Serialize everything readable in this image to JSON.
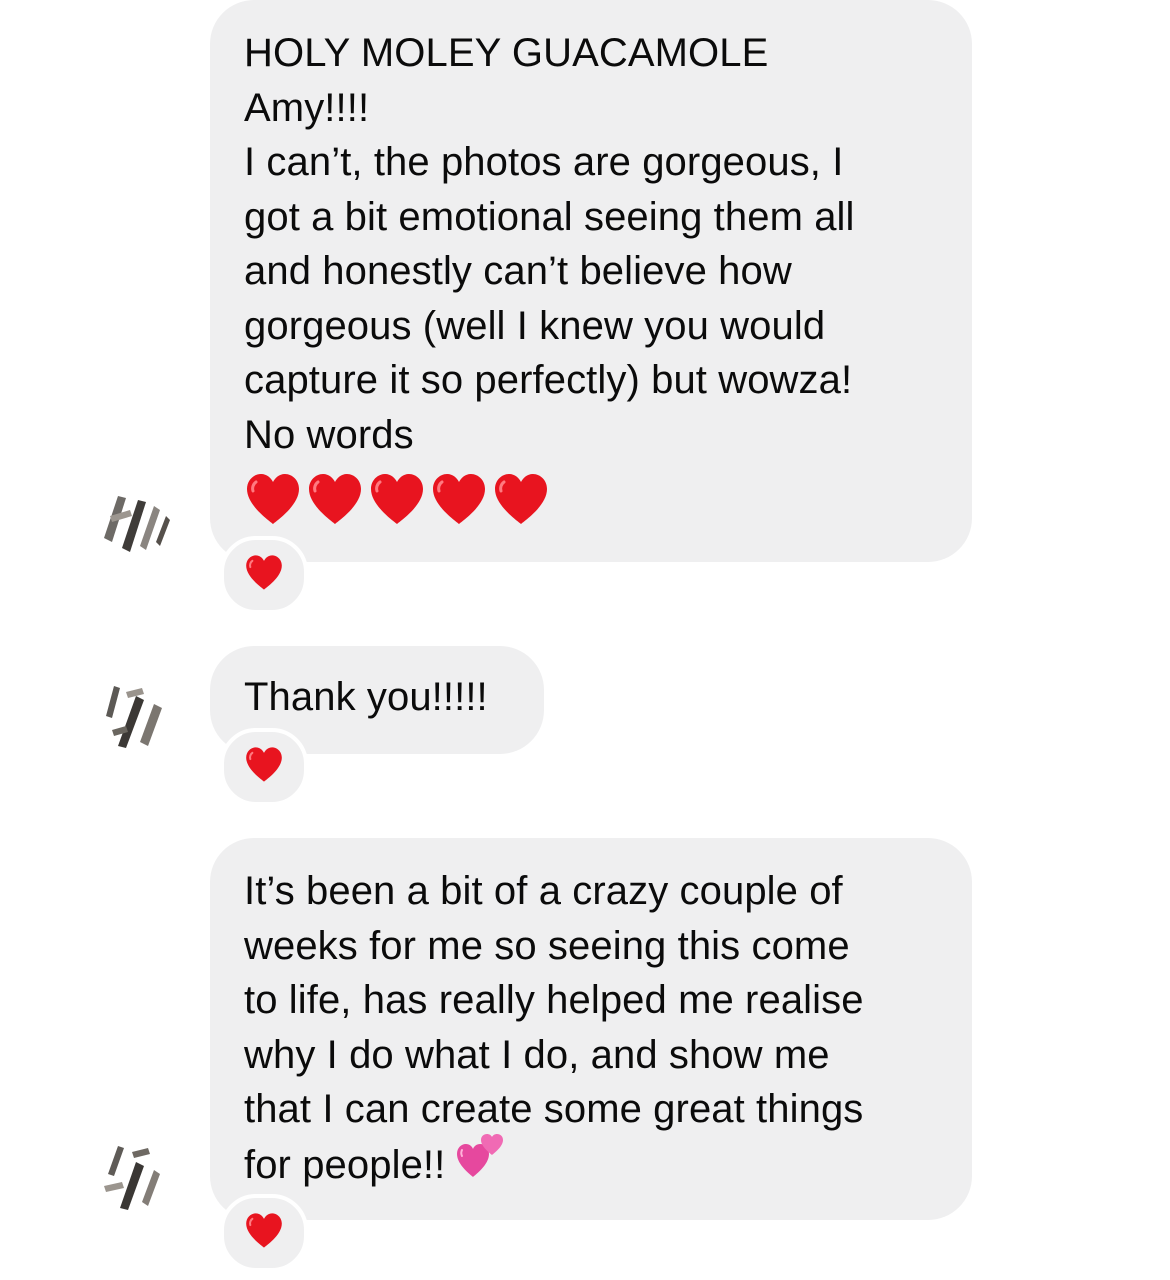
{
  "messages": [
    {
      "lines": [
        "HOLY MOLEY GUACAMOLE",
        "Amy!!!!",
        "I can’t, the photos are gorgeous, I",
        "got a bit emotional seeing them all",
        "and honestly can’t believe how",
        "gorgeous (well I knew you would",
        "capture it so perfectly) but wowza!",
        "No words"
      ],
      "trailing_emoji": [
        "red-heart",
        "red-heart",
        "red-heart",
        "red-heart",
        "red-heart"
      ],
      "reaction": "red-heart"
    },
    {
      "lines": [
        "Thank you!!!!!"
      ],
      "reaction": "red-heart"
    },
    {
      "lines": [
        "It’s been a bit of a crazy couple of",
        "weeks for me so seeing this come",
        "to life, has really helped me realise",
        "why I do what I do, and show me",
        "that I can create some great things",
        "for people!!"
      ],
      "inline_emoji": "two-hearts",
      "reaction": "red-heart"
    }
  ],
  "colors": {
    "bubble": "#efeff0",
    "text": "#0b0b0b",
    "heart_red": "#e8141f",
    "two_hearts_pink": "#e6489e"
  }
}
